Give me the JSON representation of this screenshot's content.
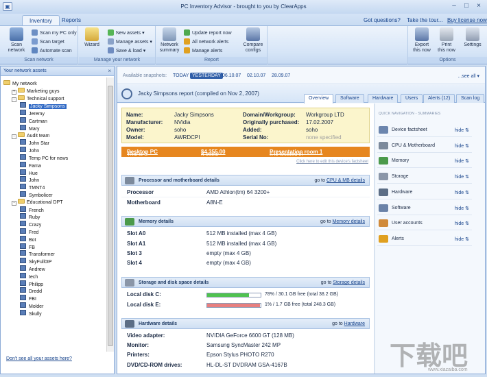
{
  "window": {
    "title": "PC Inventory Advisor - brought to you by ClearApps",
    "app_icon": "pc-icon"
  },
  "ribbon_tabs": [
    {
      "label": "Inventory",
      "active": true
    },
    {
      "label": "Reports",
      "active": false
    }
  ],
  "top_links": {
    "questions": "Got questions?",
    "tour": "Take the tour...",
    "buy": "Buy license now"
  },
  "ribbon": {
    "scan_network": {
      "label_l1": "Scan",
      "label_l2": "network",
      "group": "Scan network"
    },
    "scan_my_pc": "Scan my PC only",
    "scan_target": "Scan target",
    "automate_scan": "Automate scan",
    "wizard": "Wizard",
    "new_assets": "New assets",
    "manage_assets": "Manage assets",
    "save_load": "Save & load",
    "manage_group": "Manage your network",
    "network_summary": {
      "label_l1": "Network",
      "label_l2": "summary"
    },
    "update_report": "Update report now",
    "all_network_alerts": "All network alerts",
    "manage_alerts": "Manage alerts",
    "report_group": "Report",
    "compare_configs": {
      "label_l1": "Compare",
      "label_l2": "configs"
    },
    "export": {
      "label_l1": "Export",
      "label_l2": "this now"
    },
    "print": {
      "label_l1": "Print",
      "label_l2": "this now"
    },
    "settings": "Settings",
    "options_group": "Options"
  },
  "left_panel": {
    "title": "Your network assets",
    "footer_link": "Don't see all your assets here?",
    "tree": [
      {
        "label": "My network",
        "level": 0,
        "type": "root"
      },
      {
        "label": "Marketing guys",
        "level": 1,
        "type": "folder",
        "exp": "+"
      },
      {
        "label": "Technical support",
        "level": 1,
        "type": "folder",
        "exp": "-"
      },
      {
        "label": "Jacky Simpsons",
        "level": 2,
        "type": "pc",
        "selected": true
      },
      {
        "label": "Jeremy",
        "level": 2,
        "type": "pc"
      },
      {
        "label": "Cartman",
        "level": 2,
        "type": "pc"
      },
      {
        "label": "Mary",
        "level": 2,
        "type": "pc"
      },
      {
        "label": "Audit team",
        "level": 1,
        "type": "folder",
        "exp": "-"
      },
      {
        "label": "John Star",
        "level": 2,
        "type": "pc"
      },
      {
        "label": "John",
        "level": 2,
        "type": "pc"
      },
      {
        "label": "Temp PC for news",
        "level": 2,
        "type": "pc"
      },
      {
        "label": "Fama",
        "level": 2,
        "type": "pc"
      },
      {
        "label": "Hue",
        "level": 2,
        "type": "pc"
      },
      {
        "label": "John",
        "level": 2,
        "type": "pc"
      },
      {
        "label": "TMNT4",
        "level": 2,
        "type": "pc"
      },
      {
        "label": "Symbolicer",
        "level": 2,
        "type": "pc"
      },
      {
        "label": "Educational DPT",
        "level": 1,
        "type": "folder",
        "exp": "-"
      },
      {
        "label": "French",
        "level": 2,
        "type": "pc"
      },
      {
        "label": "Ruby",
        "level": 2,
        "type": "pc"
      },
      {
        "label": "Crazy",
        "level": 2,
        "type": "pc"
      },
      {
        "label": "Fred",
        "level": 2,
        "type": "pc"
      },
      {
        "label": "Bot",
        "level": 2,
        "type": "pc"
      },
      {
        "label": "FB",
        "level": 2,
        "type": "pc"
      },
      {
        "label": "Transformer",
        "level": 2,
        "type": "pc"
      },
      {
        "label": "SkyFull0IP",
        "level": 2,
        "type": "pc"
      },
      {
        "label": "Andrew",
        "level": 2,
        "type": "pc"
      },
      {
        "label": "tech",
        "level": 2,
        "type": "pc"
      },
      {
        "label": "Philipp",
        "level": 2,
        "type": "pc"
      },
      {
        "label": "Dredd",
        "level": 2,
        "type": "pc"
      },
      {
        "label": "FBI",
        "level": 2,
        "type": "pc"
      },
      {
        "label": "Molder",
        "level": 2,
        "type": "pc"
      },
      {
        "label": "Skully",
        "level": 2,
        "type": "pc"
      }
    ]
  },
  "snapshots": {
    "label": "Available snapshots:",
    "items": [
      {
        "label": "TODAY",
        "active": false
      },
      {
        "label": "YESTERDAY",
        "active": true
      },
      {
        "label": "06.10.07",
        "active": false
      },
      {
        "label": "02.10.07",
        "active": false
      },
      {
        "label": "28.09.07",
        "active": false
      }
    ],
    "see_all": "...see all"
  },
  "report": {
    "title": "Jacky Simpsons report (compiled on Nov 2, 2007)",
    "view_tabs": [
      "Overview",
      "Software",
      "Hardware",
      "Users",
      "Alerts (12)",
      "Scan log"
    ]
  },
  "factsheet": {
    "name_key": "Name:",
    "name": "Jacky Simpsons",
    "manufacturer_key": "Manufacturer:",
    "manufacturer": "NVidia",
    "owner_key": "Owner:",
    "owner": "soho",
    "model_key": "Model:",
    "model": "AWRDCPI",
    "domain_key": "Domain/Workgroup:",
    "domain": "Workgroup LTD",
    "purchased_key": "Originally purchased:",
    "purchased": "17.02.2007",
    "added_key": "Added:",
    "added": "soho",
    "serial_key": "Serial No:",
    "serial": "none specified",
    "type_prefix": "This is a",
    "type": "Desktop PC",
    "cost_prefix": "It costs",
    "cost": "$4,355.00",
    "location_prefix": "It is located in",
    "location": "Presentation room 1",
    "edit_link": "Click here to edit this device's factsheet"
  },
  "sections": {
    "processor": {
      "title": "Processor and motherboard details",
      "link_prefix": "go to",
      "link": "CPU & MB details",
      "rows": [
        {
          "key": "Processor",
          "value": "AMD Athlon(tm) 64 3200+"
        },
        {
          "key": "Motherboard",
          "value": "A8N-E"
        }
      ]
    },
    "memory": {
      "title": "Memory details",
      "link_prefix": "go to",
      "link": "Memory details",
      "rows": [
        {
          "key": "Slot A0",
          "value": "512 MB installed (max 4 GB)"
        },
        {
          "key": "Slot A1",
          "value": "512 MB installed (max 4 GB)"
        },
        {
          "key": "Slot 3",
          "value": "empty (max 4 GB)"
        },
        {
          "key": "Slot 4",
          "value": "empty (max 4 GB)"
        }
      ]
    },
    "storage": {
      "title": "Storage and disk space details",
      "link_prefix": "go to",
      "link": "Storage details",
      "rows": [
        {
          "key": "Local disk C:",
          "text": "78% / 30.1 GB free (total 38.2 GB)",
          "fill": 0.78,
          "color": "#4fc24f"
        },
        {
          "key": "Local disk E:",
          "text": "1% / 1.7 GB free (total 248.3 GB)",
          "fill": 0.99,
          "color": "#e77f7f"
        }
      ]
    },
    "hardware": {
      "title": "Hardware details",
      "link_prefix": "go to",
      "link": "Hardware",
      "rows": [
        {
          "key": "Video adapter:",
          "value": "NVIDIA GeForce 6600 GT (128 MB)"
        },
        {
          "key": "Monitor:",
          "value": "Samsung SyncMaster 242 MP"
        },
        {
          "key": "Printers:",
          "value": "Epson Stylus PHOTO R270"
        },
        {
          "key": "DVD/CD-ROM drives:",
          "value": "HL-DL-ST DVDRAM GSA-4167B"
        }
      ]
    }
  },
  "quick_nav": {
    "title": "QUICK NAVIGATION - SUMMARIES",
    "hide_label": "hide",
    "items": [
      {
        "label": "Device factsheet",
        "icon": "device-icon",
        "color": "#6c86ae"
      },
      {
        "label": "CPU & Motherboard",
        "icon": "cpu-icon",
        "color": "#7c8a9c"
      },
      {
        "label": "Memory",
        "icon": "memory-icon",
        "color": "#4b9a4b"
      },
      {
        "label": "Storage",
        "icon": "storage-icon",
        "color": "#8a96a8"
      },
      {
        "label": "Hardware",
        "icon": "hardware-icon",
        "color": "#5c6e86"
      },
      {
        "label": "Software",
        "icon": "software-icon",
        "color": "#6a82a8"
      },
      {
        "label": "User accounts",
        "icon": "users-icon",
        "color": "#d08a3a"
      },
      {
        "label": "Alerts",
        "icon": "alert-icon",
        "color": "#e0a020"
      }
    ]
  },
  "watermark": {
    "text": "下载吧",
    "sub": "www.xiazaiba.com"
  }
}
